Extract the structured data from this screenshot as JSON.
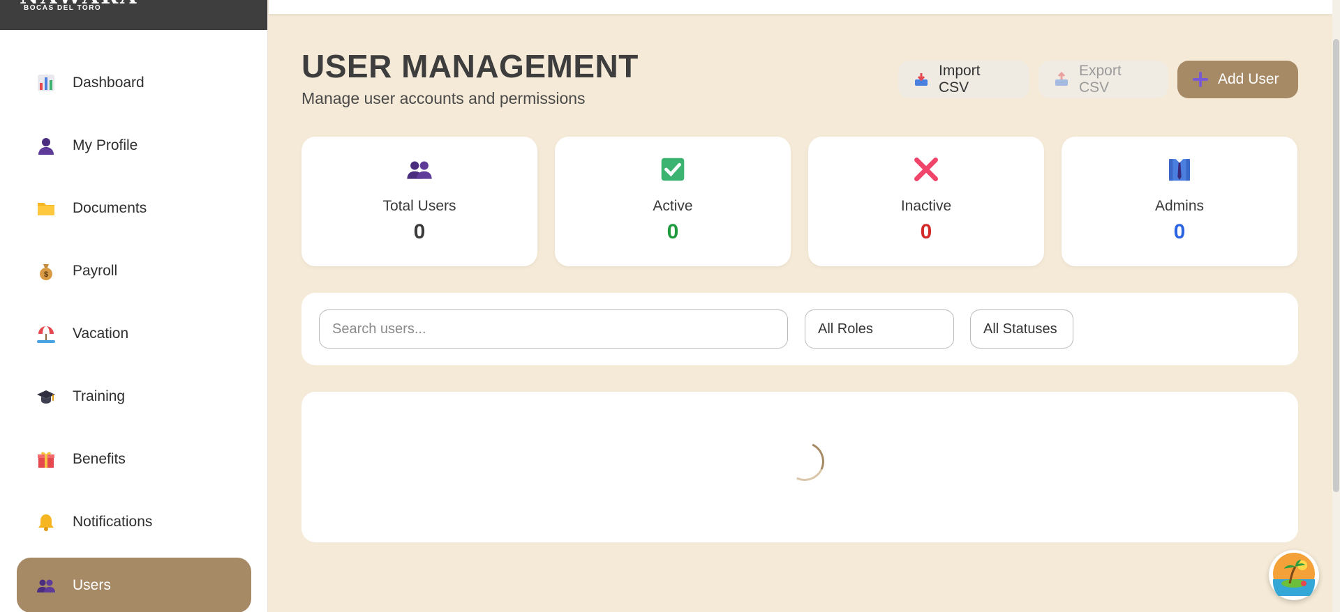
{
  "brand": {
    "logo_text": "NAWARA",
    "sub": "BOCAS DEL TORO"
  },
  "sidebar": {
    "items": [
      {
        "label": "Dashboard",
        "icon": "bar-chart-icon"
      },
      {
        "label": "My Profile",
        "icon": "user-icon"
      },
      {
        "label": "Documents",
        "icon": "folder-icon"
      },
      {
        "label": "Payroll",
        "icon": "money-bag-icon"
      },
      {
        "label": "Vacation",
        "icon": "beach-umbrella-icon"
      },
      {
        "label": "Training",
        "icon": "graduation-cap-icon"
      },
      {
        "label": "Benefits",
        "icon": "gift-icon"
      },
      {
        "label": "Notifications",
        "icon": "bell-icon"
      },
      {
        "label": "Users",
        "icon": "users-icon",
        "active": true
      }
    ]
  },
  "header": {
    "title": "USER MANAGEMENT",
    "subtitle": "Manage user accounts and permissions"
  },
  "actions": {
    "import_label": "Import CSV",
    "export_label": "Export CSV",
    "add_label": "Add User"
  },
  "stats": [
    {
      "label": "Total Users",
      "value": "0",
      "color": "#3b3b3b",
      "icon": "users-icon"
    },
    {
      "label": "Active",
      "value": "0",
      "color": "#1f9a3e",
      "icon": "checkmark-icon"
    },
    {
      "label": "Inactive",
      "value": "0",
      "color": "#d42a2a",
      "icon": "cross-icon"
    },
    {
      "label": "Admins",
      "value": "0",
      "color": "#2b63e0",
      "icon": "admin-shirt-icon"
    }
  ],
  "filters": {
    "search_placeholder": "Search users...",
    "role_selected": "All Roles",
    "status_selected": "All Statuses"
  },
  "colors": {
    "accent": "#a68965",
    "background": "#f5ead7"
  }
}
